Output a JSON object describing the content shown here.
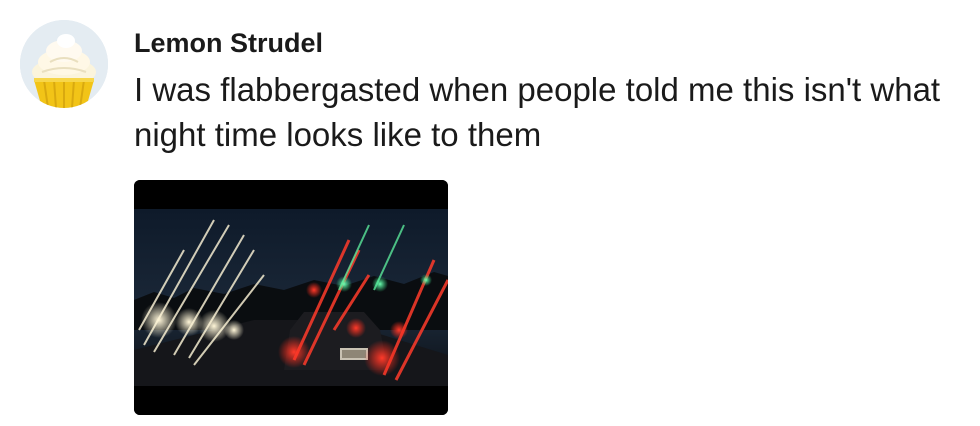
{
  "post": {
    "author": {
      "name": "Lemon Strudel",
      "avatar_icon": "cupcake-avatar-icon"
    },
    "text": "I was flabbergasted when people told me this isn't what night time looks like to them",
    "image_alt": "night-driving-photo"
  },
  "colors": {
    "text": "#1a1a1a",
    "background": "#ffffff"
  }
}
